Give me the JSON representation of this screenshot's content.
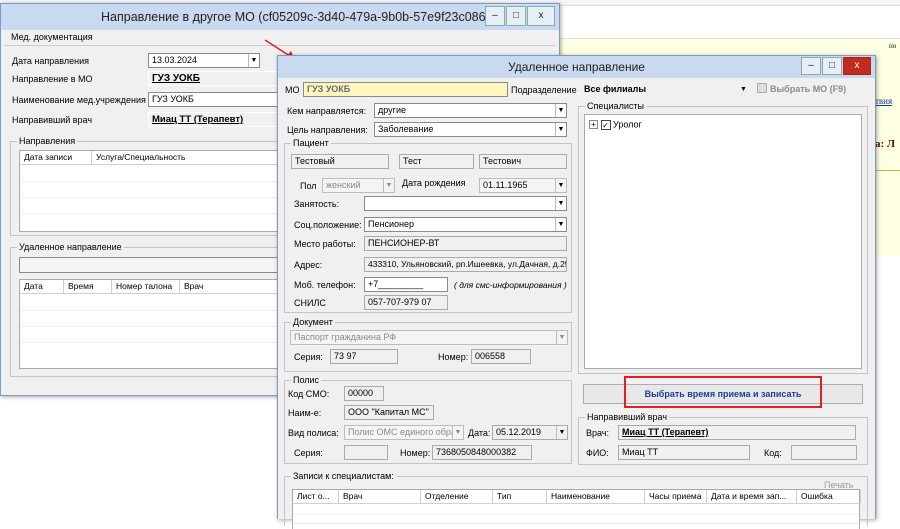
{
  "background": {
    "text_po": "по",
    "text_link": "твия",
    "text_bold": "а: Л"
  },
  "back_window": {
    "title": "Направление в другое МО (cf05209c-3d40-479a-9b0b-57e9f23c086c)",
    "menu_tab": "Мед. документация",
    "date_label": "Дата направления",
    "date_value": "13.03.2024",
    "mo_label": "Направление в МО",
    "mo_value": "ГУЗ УОКБ",
    "inst_label": "Наименование мед.учреждения",
    "inst_value": "ГУЗ УОКБ",
    "doctor_label": "Направивший врач",
    "doctor_value": "Миац ТТ (Терапевт)",
    "directions_group": "Направления",
    "directions_cols": [
      "Дата записи",
      "Услуга/Специальность"
    ],
    "remote_group": "Удаленное направление",
    "remote_cols": [
      "Дата",
      "Время",
      "Номер талона",
      "Врач"
    ]
  },
  "front_window": {
    "title": "Удаленное направление",
    "mo_label": "МО",
    "mo_value": "ГУЗ УОКБ",
    "subdiv_label": "Подразделение",
    "subdiv_value": "Все филиалы",
    "select_mo_button": "Выбрать МО (F9)",
    "sent_by_label": "Кем направляется:",
    "sent_by_value": "другие",
    "purpose_label": "Цель направления:",
    "purpose_value": "Заболевание",
    "patient_group": "Пациент",
    "last_name": "Тестовый",
    "first_name": "Тест",
    "middle_name": "Тестович",
    "sex_label": "Пол",
    "sex_value": "женский",
    "birth_label": "Дата рождения",
    "birth_value": "01.11.1965",
    "employment_label": "Занятость:",
    "employment_value": "",
    "social_label": "Соц.положение:",
    "social_value": "Пенсионер",
    "workplace_label": "Место работы:",
    "workplace_value": "ПЕНСИОНЕР-ВТ",
    "address_label": "Адрес:",
    "address_value": "433310, Ульяновский, рп.Ишеевка, ул.Дачная, д.25",
    "phone_label": "Моб. телефон:",
    "phone_value": "+7_________",
    "phone_hint": "( для смс-информирования )",
    "snils_label": "СНИЛС",
    "snils_value": "057-707-979 07",
    "document_group": "Документ",
    "doc_type": "Паспорт гражданина РФ",
    "series_label": "Серия:",
    "series_value": "73 97",
    "number_label": "Номер:",
    "number_value": "006558",
    "policy_group": "Полис",
    "smo_label": "Код СМО:",
    "smo_value": "00000",
    "name_label": "Наим-е:",
    "name_value": "ООО \"Капитал МС\"",
    "policy_type_label": "Вид полиса:",
    "policy_type_value": "Полис ОМС единого образ",
    "policy_date_label": "Дата:",
    "policy_date_value": "05.12.2019",
    "policy_series_label": "Серия:",
    "policy_series_value": "",
    "policy_number_label": "Номер:",
    "policy_number_value": "7368050848000382",
    "specialists_group": "Специалисты",
    "tree_item": "Уролог",
    "choose_time_button": "Выбрать время приема и записать",
    "ref_doctor_group": "Направивший врач",
    "doctor_label": "Врач:",
    "doctor_value": "Миац ТТ (Терапевт)",
    "fio_label": "ФИО:",
    "fio_value": "Миац ТТ",
    "code_label": "Код:",
    "code_value": "",
    "records_group": "Записи к специалистам:",
    "print_label": "Печать",
    "records_cols": [
      "Лист о...",
      "Врач",
      "Отделение",
      "Тип",
      "Наименование",
      "Часы приема",
      "Дата и время зап...",
      "Ошибка"
    ]
  },
  "colors": {
    "accent_red": "#e02020",
    "highlight": "#fff6bf",
    "link_blue": "#1a3c9a"
  }
}
